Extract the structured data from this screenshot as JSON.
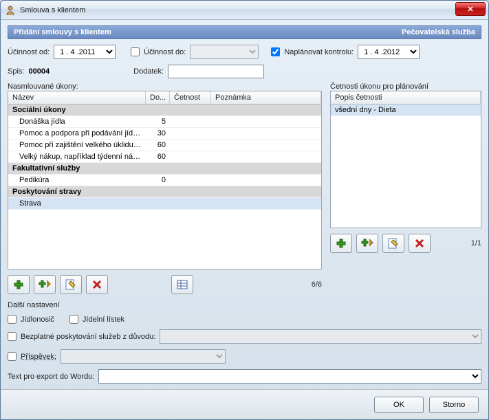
{
  "window": {
    "title": "Smlouva s klientem"
  },
  "subheader": {
    "left": "Přidání smlouvy s klientem",
    "right": "Pečovatelská služba"
  },
  "form": {
    "effective_from_label": "Účinnost od:",
    "effective_from_value": "1 . 4 .2011",
    "effective_to_check": false,
    "effective_to_label": "Účinnost do:",
    "effective_to_value": "",
    "plan_check": true,
    "plan_label": "Naplánovat kontrolu:",
    "plan_value": "1 . 4 .2012",
    "spis_label": "Spis:",
    "spis_value": "00004",
    "dodatek_label": "Dodatek:",
    "dodatek_value": ""
  },
  "left_grid": {
    "title": "Nasmlouvané úkony:",
    "headers": {
      "name": "Název",
      "do": "Do...",
      "cet": "Četnost",
      "poz": "Poznámka"
    },
    "rows": [
      {
        "type": "group",
        "name": "Sociální úkony"
      },
      {
        "type": "item",
        "name": "Donáška jídla",
        "do": "5"
      },
      {
        "type": "item",
        "name": "Pomoc a podpora při podávání jídla ...",
        "do": "30"
      },
      {
        "type": "item",
        "name": "Pomoc při zajištění velkého úklidu d...",
        "do": "60"
      },
      {
        "type": "item",
        "name": "Velký nákup, například týdenní nákup",
        "do": "60"
      },
      {
        "type": "group",
        "name": "Fakultativní služby"
      },
      {
        "type": "item",
        "name": "Pedikúra",
        "do": "0"
      },
      {
        "type": "group",
        "name": "Poskytování stravy"
      },
      {
        "type": "item",
        "name": "Strava",
        "do": "",
        "selected": true
      }
    ],
    "counter": "6/6"
  },
  "right_grid": {
    "title": "Četnosti úkonu pro plánování",
    "header": "Popis četnosti",
    "rows": [
      "všední dny - Dieta"
    ],
    "counter": "1/1"
  },
  "settings": {
    "title": "Další nastavení",
    "jidlonosic_check": false,
    "jidlonosic_label": "Jídlonosič",
    "jidelnilistek_check": false,
    "jidelnilistek_label": "Jídelní lístek",
    "bezplatne_check": false,
    "bezplatne_label": "Bezplatné poskytování služeb z důvodu:",
    "bezplatne_value": "",
    "prispevek_check": false,
    "prispevek_label": "Příspěvek:",
    "prispevek_value": "",
    "export_label": "Text pro export do Wordu:",
    "export_value": ""
  },
  "footer": {
    "ok": "OK",
    "cancel": "Storno"
  }
}
